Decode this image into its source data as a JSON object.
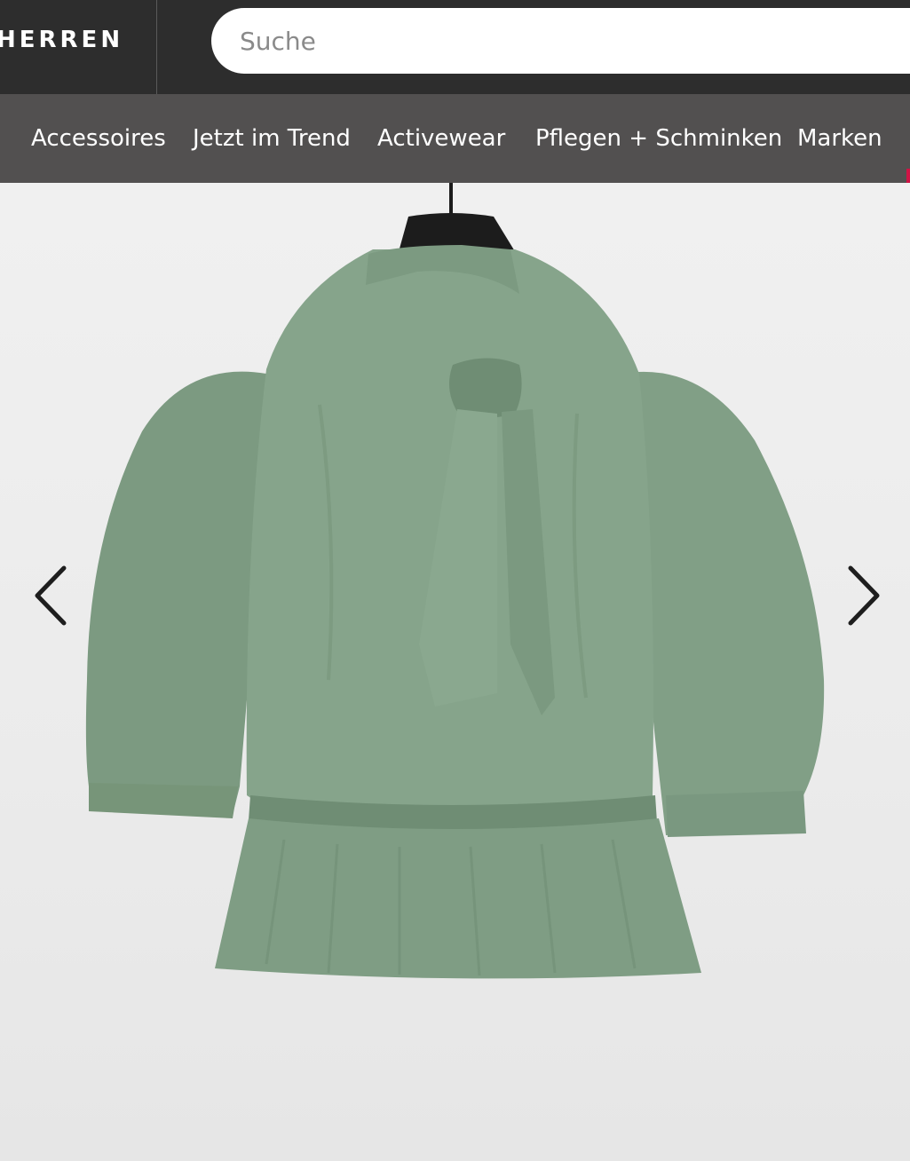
{
  "header": {
    "gender_tab": "HERREN",
    "search_placeholder": "Suche"
  },
  "nav": {
    "items": [
      {
        "label": "Accessoires"
      },
      {
        "label": "Jetzt im Trend"
      },
      {
        "label": "Activewear"
      },
      {
        "label": "Pflegen + Schminken"
      },
      {
        "label": "Marken"
      }
    ]
  },
  "gallery": {
    "image_icon": "product-blouse-image",
    "prev_icon": "chevron-left-icon",
    "next_icon": "chevron-right-icon",
    "colors": {
      "blouse": "#7f9d84",
      "hanger": "#1c1c1c",
      "background": "#ececec",
      "accent": "#d01345"
    }
  }
}
